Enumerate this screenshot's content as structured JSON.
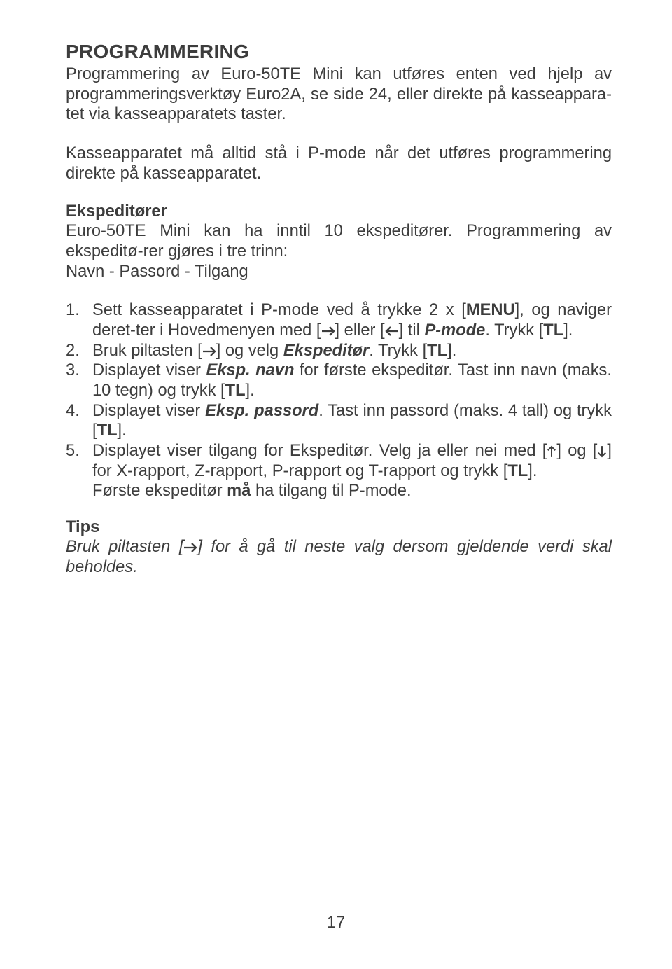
{
  "title": "PROGRAMMERING",
  "intro": {
    "t1": "Programmering av Euro-50TE Mini kan utføres enten ved hjelp av programmeringsverktøy Euro2A, se side 24, eller direkte på kasseappara-tet via kasseapparatets taster.",
    "t2": "Kasseapparatet må alltid stå i P-mode når det utføres programmering direkte på kasseapparatet."
  },
  "eksp": {
    "head": "Ekspeditører",
    "t1": "Euro-50TE Mini kan ha inntil 10 ekspeditører. Programmering av ekspeditø-rer gjøres i tre trinn:",
    "t2": "Navn  - Passord - Tilgang"
  },
  "list": {
    "i1a": "Sett kasseapparatet i P-mode ved å trykke 2 x [",
    "i1_menu": "MENU",
    "i1b": "], og naviger deret-ter i  Hovedmenyen med [",
    "i1c": "] eller [",
    "i1d": "] til ",
    "i1_pmode": "P-mode",
    "i1e": ". Trykk [",
    "i1_tl": "TL",
    "i1f": "].",
    "i2a": "Bruk piltasten [",
    "i2b": "] og velg ",
    "i2_eksp": "Ekspeditør",
    "i2c": ". Trykk [",
    "i2d": "].",
    "i3a": "Displayet viser ",
    "i3_en": "Eksp. navn",
    "i3b": " for første ekspeditør. Tast inn navn (maks. 10 tegn) og trykk [",
    "i3c": "].",
    "i4a": "Displayet viser ",
    "i4_ep": "Eksp. passord",
    "i4b": ". Tast inn passord (maks. 4 tall) og trykk [",
    "i4c": "].",
    "i5a": "Displayet viser tilgang for Ekspeditør. Velg ja eller nei med [",
    "i5b": "] og [",
    "i5c": "] for X-rapport, Z-rapport, P-rapport og T-rapport og trykk [",
    "i5d": "].",
    "i5e": "Første ekspeditør ",
    "i5_ma": "må",
    "i5f": " ha tilgang til P-mode."
  },
  "tips": {
    "head": "Tips",
    "a": "Bruk piltasten [",
    "b": "] for å gå til neste valg dersom gjeldende verdi skal beholdes."
  },
  "page_number": "17",
  "TL": "TL"
}
